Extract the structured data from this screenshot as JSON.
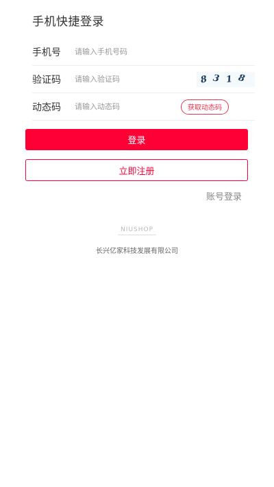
{
  "page": {
    "title": "手机快捷登录"
  },
  "form": {
    "phone": {
      "label": "手机号",
      "placeholder": "请输入手机号码"
    },
    "captcha": {
      "label": "验证码",
      "placeholder": "请输入验证码",
      "image_text": [
        "8",
        "3",
        "1",
        "8"
      ]
    },
    "dynamic_code": {
      "label": "动态码",
      "placeholder": "请输入动态码",
      "button_label": "获取动态码"
    }
  },
  "actions": {
    "login_label": "登录",
    "register_label": "立即注册",
    "account_login_label": "账号登录"
  },
  "footer": {
    "logo_text": "NIUSHOP",
    "company": "长兴亿家科技发展有限公司"
  },
  "colors": {
    "accent": "#ff0036",
    "text": "#333333",
    "muted": "#999999"
  }
}
